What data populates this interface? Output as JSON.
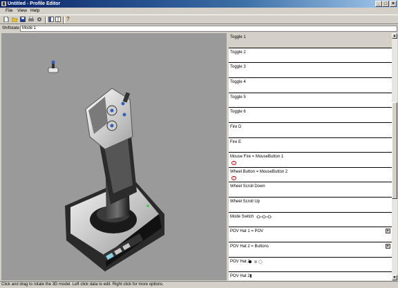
{
  "window": {
    "title": "Untitled - Profile Editor"
  },
  "menu": [
    "File",
    "View",
    "Help"
  ],
  "toolbar": {
    "icons": [
      "new-icon",
      "open-icon",
      "save-icon",
      "print-icon",
      "settings-icon",
      "layout-left-icon",
      "layout-split-icon",
      "help-icon"
    ],
    "help_glyph": "?"
  },
  "shiftstate": {
    "label": "Shiftstate",
    "value": "Mode 1"
  },
  "rows": [
    {
      "label": "Toggle 1"
    },
    {
      "label": "Toggle 2"
    },
    {
      "label": "Toggle 3"
    },
    {
      "label": "Toggle 4"
    },
    {
      "label": "Toggle 5"
    },
    {
      "label": "Toggle 6"
    },
    {
      "label": "Fire D"
    },
    {
      "label": "Fire E"
    },
    {
      "label": "Mouse Fire = MouseButton 1",
      "icon": "1"
    },
    {
      "label": "Wheel Button = MouseButton 2",
      "icon": "2"
    },
    {
      "label": "Wheel Scroll Down"
    },
    {
      "label": "Wheel Scroll Up"
    },
    {
      "label": "Mode Switch"
    },
    {
      "label": "POV Hat 1 = POV"
    },
    {
      "label": "POV Hat 2 = Buttons"
    },
    {
      "label": "POV Hat 2"
    },
    {
      "label": "POV Hat 2"
    }
  ],
  "status": "Click and drag to rotate the 3D model. Left click data to edit. Right click for more options."
}
